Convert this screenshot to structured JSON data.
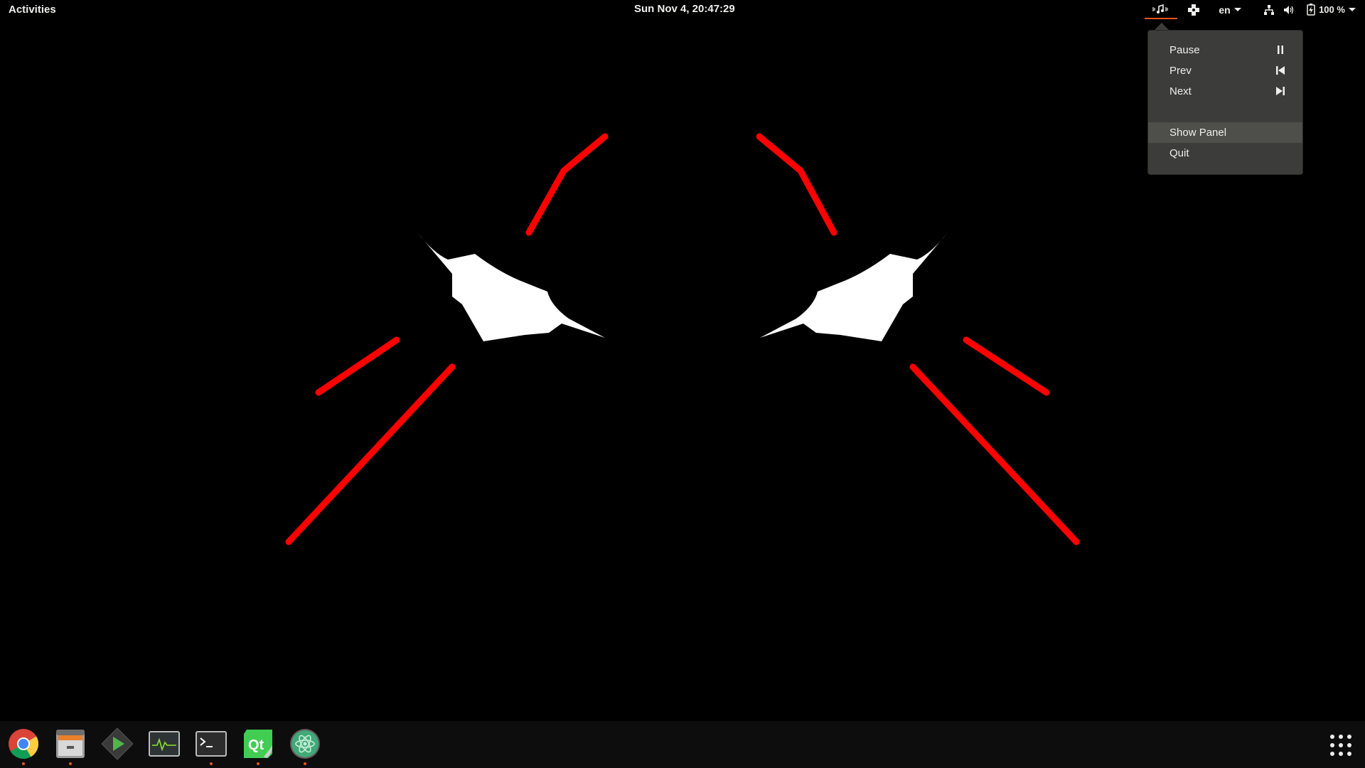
{
  "topbar": {
    "activities_label": "Activities",
    "clock": "Sun Nov  4, 20:47:29",
    "language": "en",
    "battery_percent": "100 %"
  },
  "music_menu": {
    "items": [
      {
        "label": "Pause",
        "icon": "pause-icon"
      },
      {
        "label": "Prev",
        "icon": "skip-previous-icon"
      },
      {
        "label": "Next",
        "icon": "skip-next-icon"
      },
      {
        "label": "Show Panel",
        "icon": ""
      },
      {
        "label": "Quit",
        "icon": ""
      }
    ],
    "highlighted_index": 3
  },
  "dock": {
    "apps": [
      {
        "name": "chrome",
        "running": true
      },
      {
        "name": "file-manager",
        "running": true
      },
      {
        "name": "emby-player",
        "running": false
      },
      {
        "name": "system-monitor",
        "running": false
      },
      {
        "name": "terminal",
        "running": true
      },
      {
        "name": "qt-creator",
        "running": true
      },
      {
        "name": "atom-editor",
        "running": true
      }
    ]
  },
  "colors": {
    "accent": "#e95420",
    "wallpaper_red": "#ff0000",
    "wallpaper_white": "#ffffff",
    "menu_bg": "#3c3c3a"
  }
}
